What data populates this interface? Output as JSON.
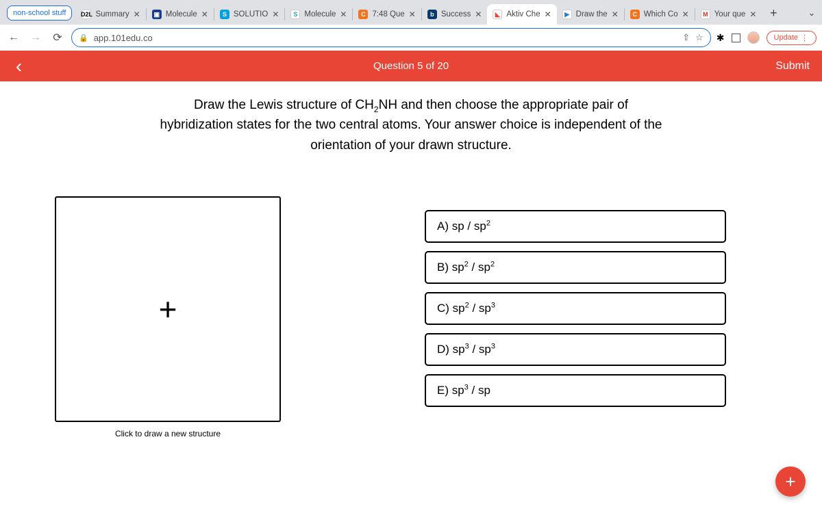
{
  "browser": {
    "group_label": "non-school stuff",
    "tabs": [
      {
        "favbg": "#fff",
        "favcolor": "#000",
        "favtext": "D2L",
        "title": "Summary"
      },
      {
        "favbg": "#1a3c8c",
        "favcolor": "#fff",
        "favtext": "▣",
        "title": "Molecule"
      },
      {
        "favbg": "#00a3e0",
        "favcolor": "#fff",
        "favtext": "S",
        "title": "SOLUTIO"
      },
      {
        "favbg": "#fff",
        "favcolor": "#2aa0d8",
        "favtext": "S",
        "title": "Molecule"
      },
      {
        "favbg": "#f4731f",
        "favcolor": "#fff",
        "favtext": "C",
        "title": "7:48 Que"
      },
      {
        "favbg": "#0a3a6b",
        "favcolor": "#fff",
        "favtext": "b",
        "title": "Success"
      },
      {
        "favbg": "#fff",
        "favcolor": "#e84537",
        "favtext": "◣",
        "title": "Aktiv Che",
        "active": true
      },
      {
        "favbg": "#fff",
        "favcolor": "#2a7ac7",
        "favtext": "▶",
        "title": "Draw the"
      },
      {
        "favbg": "#f4731f",
        "favcolor": "#fff",
        "favtext": "C",
        "title": "Which Co"
      },
      {
        "favbg": "#fff",
        "favcolor": "#d93025",
        "favtext": "M",
        "title": "Your que"
      }
    ],
    "url": "app.101edu.co",
    "update_label": "Update"
  },
  "question": {
    "counter": "Question 5 of 20",
    "submit": "Submit",
    "text_html": "Draw the Lewis structure of CH<sub>2</sub>NH and then choose the appropriate pair of hybridization states for the two central atoms. Your answer choice is independent of the orientation of your drawn structure.",
    "draw_caption": "Click to draw a new structure",
    "options": [
      "A) sp / sp<sup>2</sup>",
      "B) sp<sup>2</sup> / sp<sup>2</sup>",
      "C) sp<sup>2</sup> / sp<sup>3</sup>",
      "D) sp<sup>3</sup> / sp<sup>3</sup>",
      "E) sp<sup>3</sup> / sp"
    ]
  }
}
